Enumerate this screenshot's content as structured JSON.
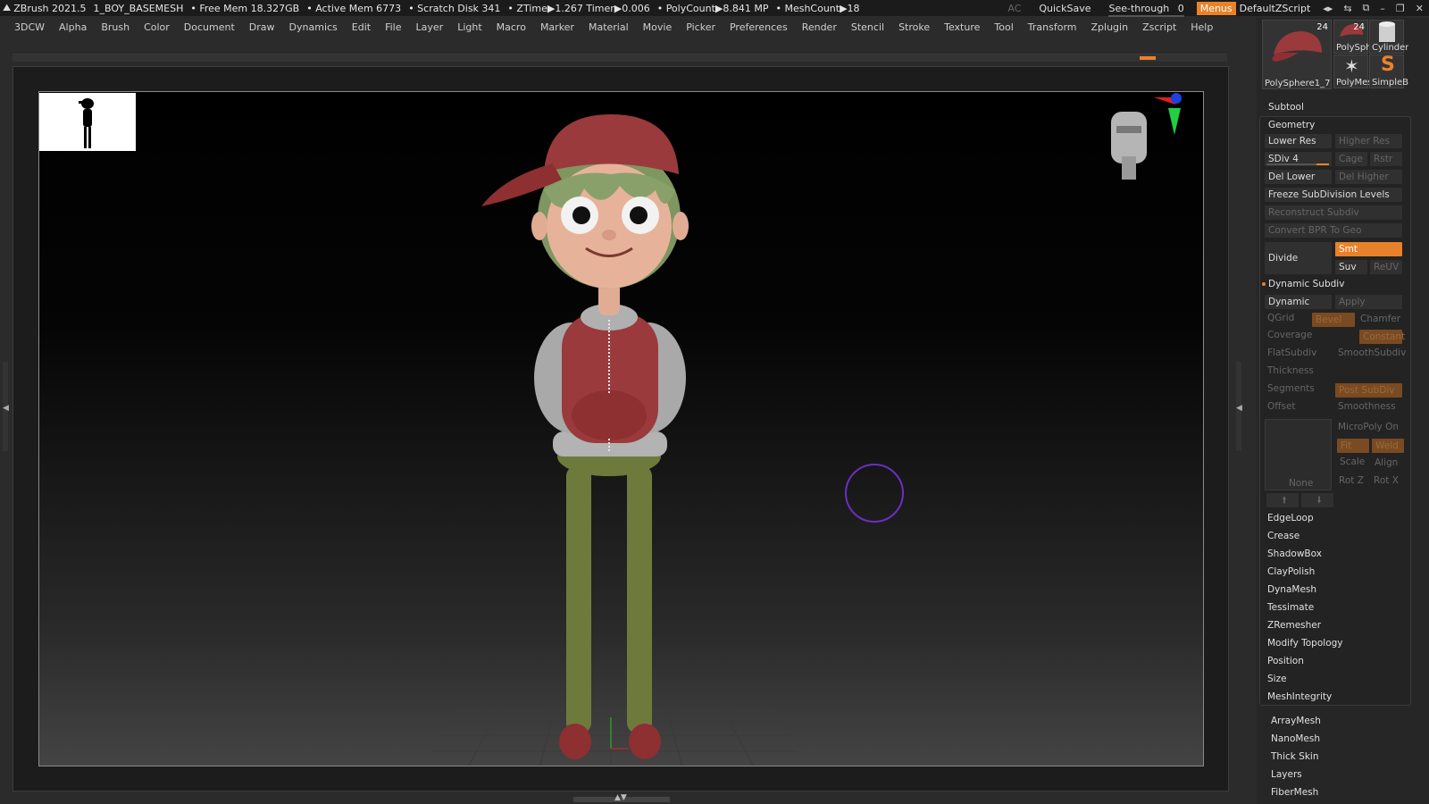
{
  "titlebar": {
    "app": "ZBrush 2021.5",
    "document": "1_BOY_BASEMESH",
    "free_mem": "• Free Mem 18.327GB",
    "active_mem": "• Active Mem 6773",
    "scratch": "• Scratch Disk 341",
    "ztime": "• ZTime▶1.267 Timer▶0.006",
    "polycount": "• PolyCount▶8.841 MP",
    "meshcount": "• MeshCount▶18",
    "ac": "AC",
    "quicksave": "QuickSave",
    "see_through_label": "See-through",
    "see_through_value": "0",
    "menus": "Menus",
    "zscript": "DefaultZScript"
  },
  "menubar": [
    "3DCW",
    "Alpha",
    "Brush",
    "Color",
    "Document",
    "Draw",
    "Dynamics",
    "Edit",
    "File",
    "Layer",
    "Light",
    "Macro",
    "Marker",
    "Material",
    "Movie",
    "Picker",
    "Preferences",
    "Render",
    "Stencil",
    "Stroke",
    "Texture",
    "Tool",
    "Transform",
    "Zplugin",
    "Zscript",
    "Help"
  ],
  "tools": {
    "main": {
      "label": "PolySphere1_7",
      "count": "24"
    },
    "polysph": {
      "label": "PolySph",
      "count": "24"
    },
    "cylinder": {
      "label": "Cylinder"
    },
    "polymesh": {
      "label": "PolyMes"
    },
    "simpleb": {
      "label": "SimpleB"
    }
  },
  "subtool": "Subtool",
  "geometry": {
    "title": "Geometry",
    "lower_res": "Lower Res",
    "higher_res": "Higher Res",
    "sdiv": "SDiv 4",
    "cage": "Cage",
    "rstr": "Rstr",
    "del_lower": "Del Lower",
    "del_higher": "Del Higher",
    "freeze": "Freeze SubDivision Levels",
    "reconstruct": "Reconstruct Subdiv",
    "convert": "Convert BPR To Geo",
    "divide": "Divide",
    "smt": "Smt",
    "suv": "Suv",
    "reuv": "ReUV"
  },
  "dynamic_subdiv": {
    "title": "Dynamic Subdiv",
    "dynamic": "Dynamic",
    "apply": "Apply",
    "qgrid": "QGrid",
    "bevel": "Bevel",
    "chamfer": "Chamfer",
    "coverage": "Coverage",
    "constant": "Constant",
    "flatsubdiv": "FlatSubdiv",
    "smoothsubdiv": "SmoothSubdiv",
    "thickness": "Thickness",
    "segments": "Segments",
    "post_subdiv": "Post SubDiv",
    "offset": "Offset",
    "smoothness": "Smoothness",
    "micropoly": "MicroPoly On",
    "fit": "Fit",
    "weld": "Weld",
    "scale": "Scale",
    "align": "Align",
    "none": "None",
    "rotz": "Rot Z",
    "rotx": "Rot X"
  },
  "geometry_sections": [
    "EdgeLoop",
    "Crease",
    "ShadowBox",
    "ClayPolish",
    "DynaMesh",
    "Tessimate",
    "ZRemesher",
    "Modify Topology",
    "Position",
    "Size",
    "MeshIntegrity"
  ],
  "tool_sections": [
    "ArrayMesh",
    "NanoMesh",
    "Thick Skin",
    "Layers",
    "FiberMesh"
  ],
  "colors": {
    "accent": "#e8822a",
    "cap": "#9a3a3c",
    "jacket_gray": "#a9a9a9",
    "pants": "#6e7a3c",
    "skin": "#e6b39a",
    "hair": "#8aa06a",
    "brush_cursor": "#6b2fc0"
  }
}
